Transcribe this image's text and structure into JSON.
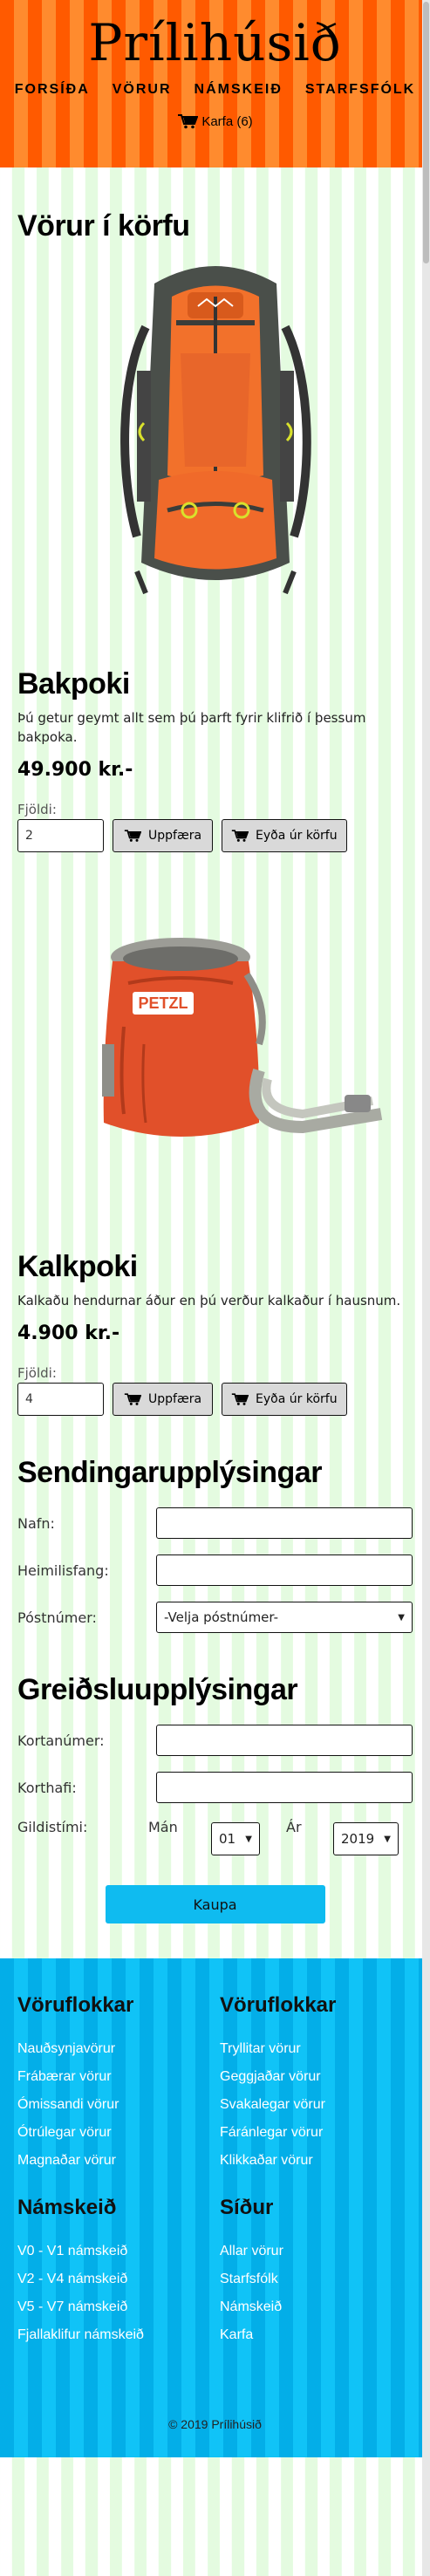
{
  "site": {
    "title": "Prílihúsið"
  },
  "nav": {
    "items": [
      "FORSÍÐA",
      "VÖRUR",
      "NÁMSKEIÐ",
      "STARFSFÓLK"
    ],
    "cart_label": "Karfa (6)"
  },
  "page": {
    "title": "Vörur í körfu"
  },
  "products": [
    {
      "name": "Bakpoki",
      "description": "Þú getur geymt allt sem þú þarft fyrir klifrið í þessum bakpoka.",
      "price": "49.900 kr.-",
      "qty_label": "Fjöldi:",
      "qty": "2",
      "update_label": "Uppfæra",
      "remove_label": "Eyða úr körfu"
    },
    {
      "name": "Kalkpoki",
      "description": "Kalkaðu hendurnar áður en þú verður kalkaður í hausnum.",
      "price": "4.900 kr.-",
      "qty_label": "Fjöldi:",
      "qty": "4",
      "update_label": "Uppfæra",
      "remove_label": "Eyða úr körfu"
    }
  ],
  "shipping": {
    "title": "Sendingarupplýsingar",
    "name_label": "Nafn:",
    "address_label": "Heimilisfang:",
    "postcode_label": "Póstnúmer:",
    "postcode_value": "-Velja póstnúmer-"
  },
  "payment": {
    "title": "Greiðsluupplýsingar",
    "card_label": "Kortanúmer:",
    "holder_label": "Korthafi:",
    "expiry_label": "Gildistími:",
    "month_label": "Mán",
    "month_value": "01",
    "year_label": "Ár",
    "year_value": "2019",
    "buy_label": "Kaupa"
  },
  "footer": {
    "col1": {
      "title": "Vöruflokkar",
      "links": [
        "Nauðsynjavörur",
        "Frábærar vörur",
        "Ómissandi vörur",
        "Ótrúlegar vörur",
        "Magnaðar vörur"
      ]
    },
    "col2": {
      "title": "Vöruflokkar",
      "links": [
        "Tryllitar vörur",
        "Geggjaðar vörur",
        "Svakalegar vörur",
        "Fáránlegar vörur",
        "Klikkaðar vörur"
      ]
    },
    "col3": {
      "title": "Námskeið",
      "links": [
        "V0 - V1 námskeið",
        "V2 - V4 námskeið",
        "V5 - V7 námskeið",
        "Fjallaklifur námskeið"
      ]
    },
    "col4": {
      "title": "Síður",
      "links": [
        "Allar vörur",
        "Starfsfólk",
        "Námskeið",
        "Karfa"
      ]
    },
    "copyright": "© 2019 Prílihúsið"
  }
}
